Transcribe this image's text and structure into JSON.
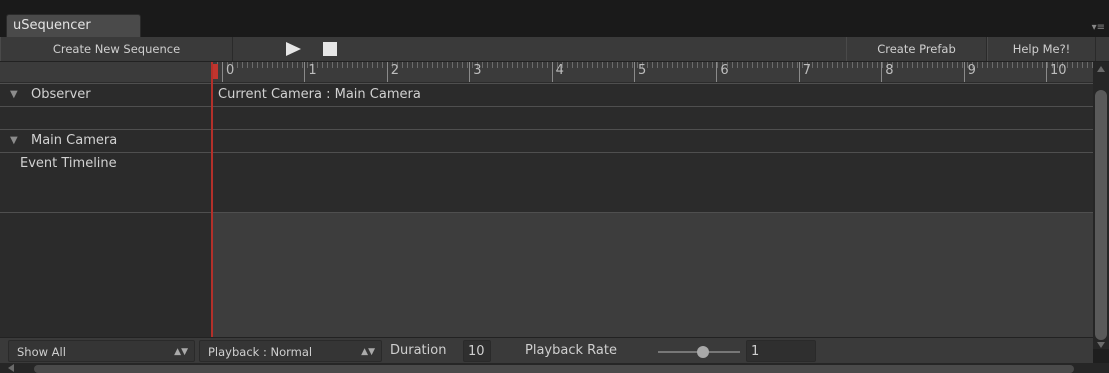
{
  "window": {
    "tab_title": "uSequencer",
    "panel_menu_glyph": "▾≡"
  },
  "toolbar": {
    "create_new_sequence": "Create New Sequence",
    "play_icon": "play-icon",
    "stop_icon": "stop-icon",
    "create_prefab": "Create Prefab",
    "help": "Help Me?!"
  },
  "ruler": {
    "labels": [
      "0",
      "1",
      "2",
      "3",
      "4",
      "5",
      "6",
      "7",
      "8",
      "9",
      "10"
    ]
  },
  "rows": {
    "observer_label": "Observer",
    "observer_value": "Current Camera : Main Camera",
    "main_camera_label": "Main Camera",
    "event_timeline_label": "Event Timeline"
  },
  "bottom": {
    "show_dropdown": "Show All",
    "playback_dropdown": "Playback : Normal",
    "duration_label": "Duration",
    "duration_value": "10",
    "playback_rate_label": "Playback Rate",
    "playback_rate_value": "1",
    "playback_rate_slider_fraction": 0.55
  },
  "colors": {
    "playhead": "#c0352e",
    "background": "#2b2b2b"
  }
}
